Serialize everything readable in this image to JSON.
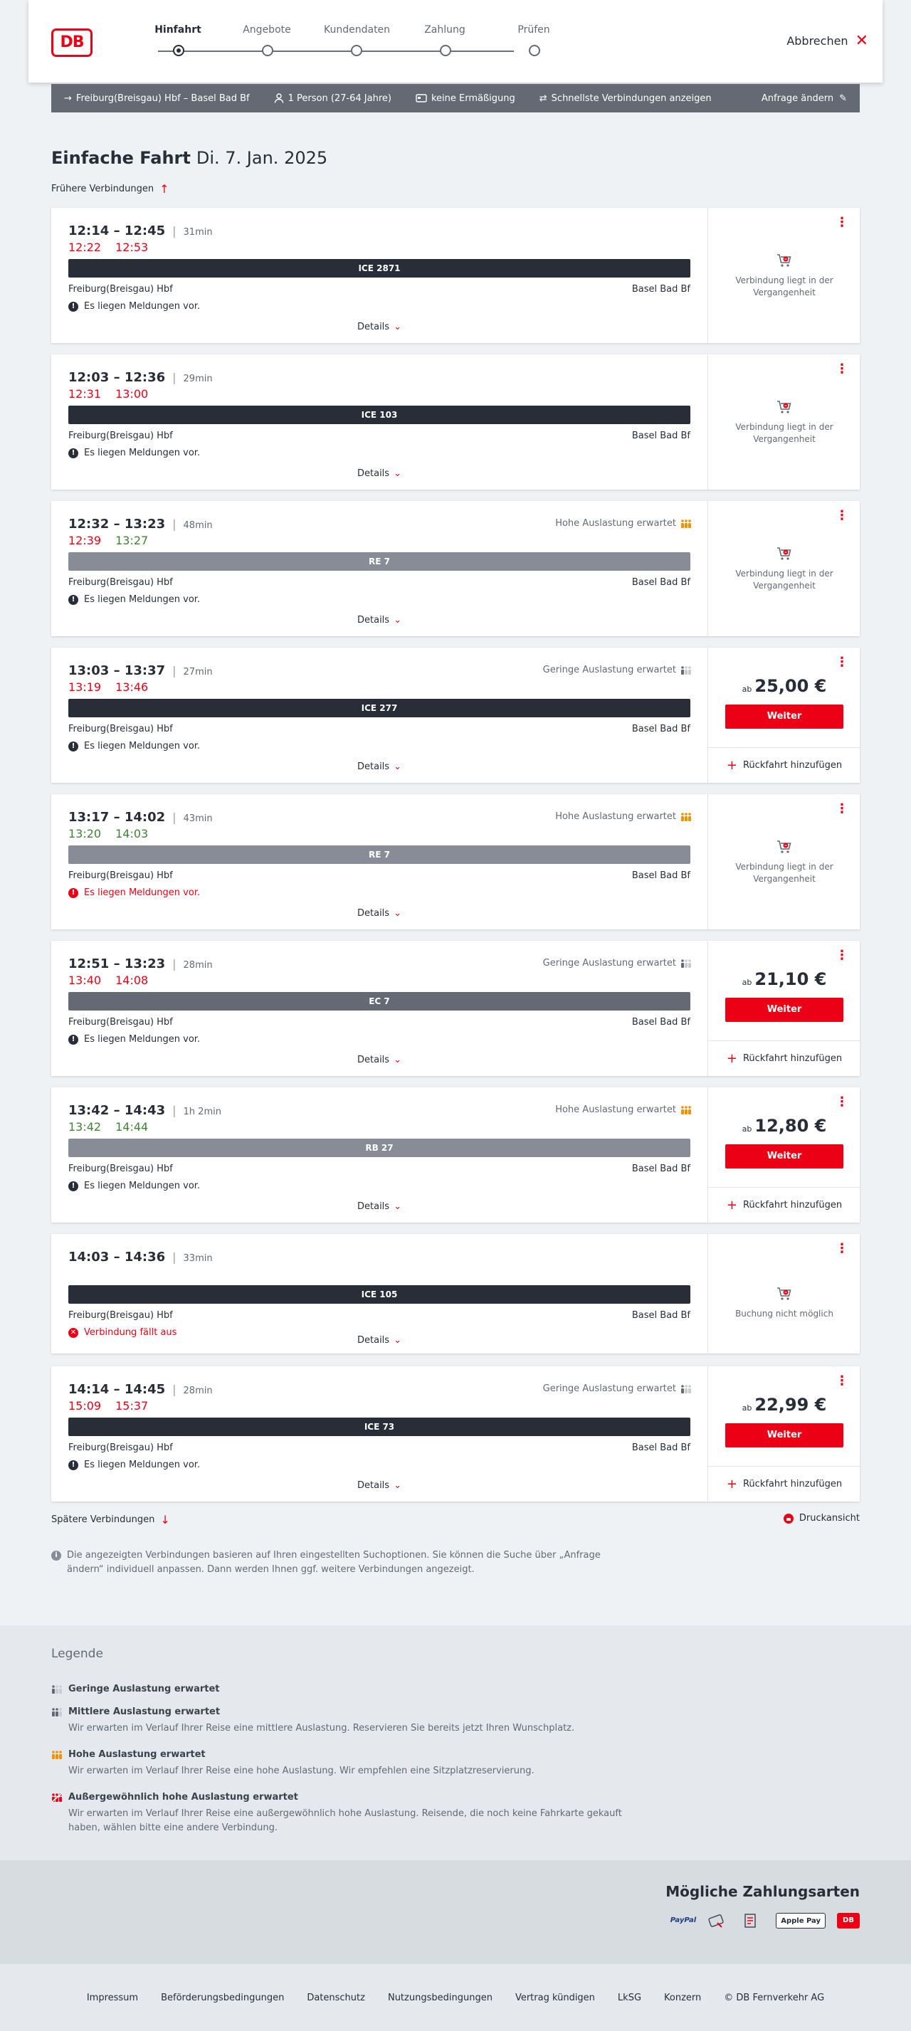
{
  "header": {
    "logo": "DB",
    "steps": [
      {
        "label": "Hinfahrt",
        "active": true
      },
      {
        "label": "Angebote",
        "active": false
      },
      {
        "label": "Kundendaten",
        "active": false
      },
      {
        "label": "Zahlung",
        "active": false
      },
      {
        "label": "Prüfen",
        "active": false
      }
    ],
    "cancel_label": "Abbrechen"
  },
  "query": {
    "route": "Freiburg(Breisgau) Hbf – Basel Bad Bf",
    "travellers": "1 Person (27-64 Jahre)",
    "discount": "keine Ermäßigung",
    "mode": "Schnellste Verbindungen anzeigen",
    "change_label": "Anfrage ändern"
  },
  "trip": {
    "type": "Einfache Fahrt",
    "date": "Di. 7. Jan. 2025"
  },
  "earlier_label": "Frühere Verbindungen",
  "later_label": "Spätere Verbindungen",
  "print_label": "Druckansicht",
  "details_label": "Details",
  "continue_label": "Weiter",
  "return_label": "Rückfahrt hinzufügen",
  "price_prefix": "ab",
  "connections": [
    {
      "dep": "12:14",
      "arr": "12:45",
      "dur": "31min",
      "rt_dep": "12:22",
      "rt_arr": "12:53",
      "rt_dep_state": "late",
      "rt_arr_state": "late",
      "load": "",
      "train": "ICE 2871",
      "train_color": "#282d37",
      "from": "Freiburg(Breisgau) Hbf",
      "to": "Basel Bad Bf",
      "msg": "Es liegen Meldungen vor.",
      "msg_state": "normal",
      "status": "past",
      "status_text": "Verbindung liegt in der Vergangenheit",
      "price": ""
    },
    {
      "dep": "12:03",
      "arr": "12:36",
      "dur": "29min",
      "rt_dep": "12:31",
      "rt_arr": "13:00",
      "rt_dep_state": "late",
      "rt_arr_state": "late",
      "load": "",
      "train": "ICE 103",
      "train_color": "#282d37",
      "from": "Freiburg(Breisgau) Hbf",
      "to": "Basel Bad Bf",
      "msg": "Es liegen Meldungen vor.",
      "msg_state": "normal",
      "status": "past",
      "status_text": "Verbindung liegt in der Vergangenheit",
      "price": ""
    },
    {
      "dep": "12:32",
      "arr": "13:23",
      "dur": "48min",
      "rt_dep": "12:39",
      "rt_arr": "13:27",
      "rt_dep_state": "late",
      "rt_arr_state": "ok",
      "load": "Hohe Auslastung erwartet",
      "load_level": "high",
      "train": "RE 7",
      "train_color": "#878c96",
      "from": "Freiburg(Breisgau) Hbf",
      "to": "Basel Bad Bf",
      "msg": "Es liegen Meldungen vor.",
      "msg_state": "normal",
      "status": "past",
      "status_text": "Verbindung liegt in der Vergangenheit",
      "price": ""
    },
    {
      "dep": "13:03",
      "arr": "13:37",
      "dur": "27min",
      "rt_dep": "13:19",
      "rt_arr": "13:46",
      "rt_dep_state": "late",
      "rt_arr_state": "late",
      "load": "Geringe Auslastung erwartet",
      "load_level": "low",
      "train": "ICE 277",
      "train_color": "#282d37",
      "from": "Freiburg(Breisgau) Hbf",
      "to": "Basel Bad Bf",
      "msg": "Es liegen Meldungen vor.",
      "msg_state": "normal",
      "status": "bookable",
      "status_text": "",
      "price": "25,00 €"
    },
    {
      "dep": "13:17",
      "arr": "14:02",
      "dur": "43min",
      "rt_dep": "13:20",
      "rt_arr": "14:03",
      "rt_dep_state": "ok",
      "rt_arr_state": "ok",
      "load": "Hohe Auslastung erwartet",
      "load_level": "high",
      "train": "RE 7",
      "train_color": "#878c96",
      "from": "Freiburg(Breisgau) Hbf",
      "to": "Basel Bad Bf",
      "msg": "Es liegen Meldungen vor.",
      "msg_state": "red",
      "status": "past",
      "status_text": "Verbindung liegt in der Vergangenheit",
      "price": ""
    },
    {
      "dep": "12:51",
      "arr": "13:23",
      "dur": "28min",
      "rt_dep": "13:40",
      "rt_arr": "14:08",
      "rt_dep_state": "late",
      "rt_arr_state": "late",
      "load": "Geringe Auslastung erwartet",
      "load_level": "low",
      "train": "EC 7",
      "train_color": "#646973",
      "from": "Freiburg(Breisgau) Hbf",
      "to": "Basel Bad Bf",
      "msg": "Es liegen Meldungen vor.",
      "msg_state": "normal",
      "status": "bookable",
      "status_text": "",
      "price": "21,10 €"
    },
    {
      "dep": "13:42",
      "arr": "14:43",
      "dur": "1h 2min",
      "rt_dep": "13:42",
      "rt_arr": "14:44",
      "rt_dep_state": "ok",
      "rt_arr_state": "ok",
      "load": "Hohe Auslastung erwartet",
      "load_level": "high",
      "train": "RB 27",
      "train_color": "#878c96",
      "from": "Freiburg(Breisgau) Hbf",
      "to": "Basel Bad Bf",
      "msg": "Es liegen Meldungen vor.",
      "msg_state": "normal",
      "status": "bookable",
      "status_text": "",
      "price": "12,80 €"
    },
    {
      "dep": "14:03",
      "arr": "14:36",
      "dur": "33min",
      "rt_dep": "",
      "rt_arr": "",
      "rt_dep_state": "",
      "rt_arr_state": "",
      "load": "",
      "train": "ICE 105",
      "train_color": "#282d37",
      "from": "Freiburg(Breisgau) Hbf",
      "to": "Basel Bad Bf",
      "msg": "Verbindung fällt aus",
      "msg_state": "cancelled",
      "status": "impossible",
      "status_text": "Buchung nicht möglich",
      "price": ""
    },
    {
      "dep": "14:14",
      "arr": "14:45",
      "dur": "28min",
      "rt_dep": "15:09",
      "rt_arr": "15:37",
      "rt_dep_state": "late",
      "rt_arr_state": "late",
      "load": "Geringe Auslastung erwartet",
      "load_level": "low",
      "train": "ICE 73",
      "train_color": "#282d37",
      "from": "Freiburg(Breisgau) Hbf",
      "to": "Basel Bad Bf",
      "msg": "Es liegen Meldungen vor.",
      "msg_state": "normal",
      "status": "bookable",
      "status_text": "",
      "price": "22,99 €"
    }
  ],
  "info_text": "Die angezeigten Verbindungen basieren auf Ihren eingestellten Suchoptionen. Sie können die Suche über „Anfrage ändern“ individuell anpassen. Dann werden Ihnen ggf. weitere Verbindungen angezeigt.",
  "legend": {
    "title": "Legende",
    "items": [
      {
        "title": "Geringe Auslastung erwartet",
        "desc": "",
        "level": "low"
      },
      {
        "title": "Mittlere Auslastung erwartet",
        "desc": "Wir erwarten im Verlauf Ihrer Reise eine mittlere Auslastung. Reservieren Sie bereits jetzt Ihren Wunschplatz.",
        "level": "mid"
      },
      {
        "title": "Hohe Auslastung erwartet",
        "desc": "Wir erwarten im Verlauf Ihrer Reise eine hohe Auslastung. Wir empfehlen eine Sitzplatzreservierung.",
        "level": "high"
      },
      {
        "title": "Außergewöhnlich hohe Auslastung erwartet",
        "desc": "Wir erwarten im Verlauf Ihrer Reise eine außergewöhnlich hohe Auslastung. Reisende, die noch keine Fahrkarte gekauft haben, wählen bitte eine andere Verbindung.",
        "level": "extreme"
      }
    ]
  },
  "payment": {
    "title": "Mögliche Zahlungsarten",
    "methods": [
      "PayPal",
      "Kreditkarte",
      "Lastschrift",
      "Apple Pay",
      "DB"
    ]
  },
  "footer": {
    "links": [
      "Impressum",
      "Beförderungsbedingungen",
      "Datenschutz",
      "Nutzungsbedingungen",
      "Vertrag kündigen",
      "LkSG",
      "Konzern",
      "© DB Fernverkehr AG"
    ]
  },
  "colors": {
    "brand": "#ec0016",
    "delay": "#ec0016",
    "ontime": "#408335",
    "load_high": "#f39200"
  }
}
